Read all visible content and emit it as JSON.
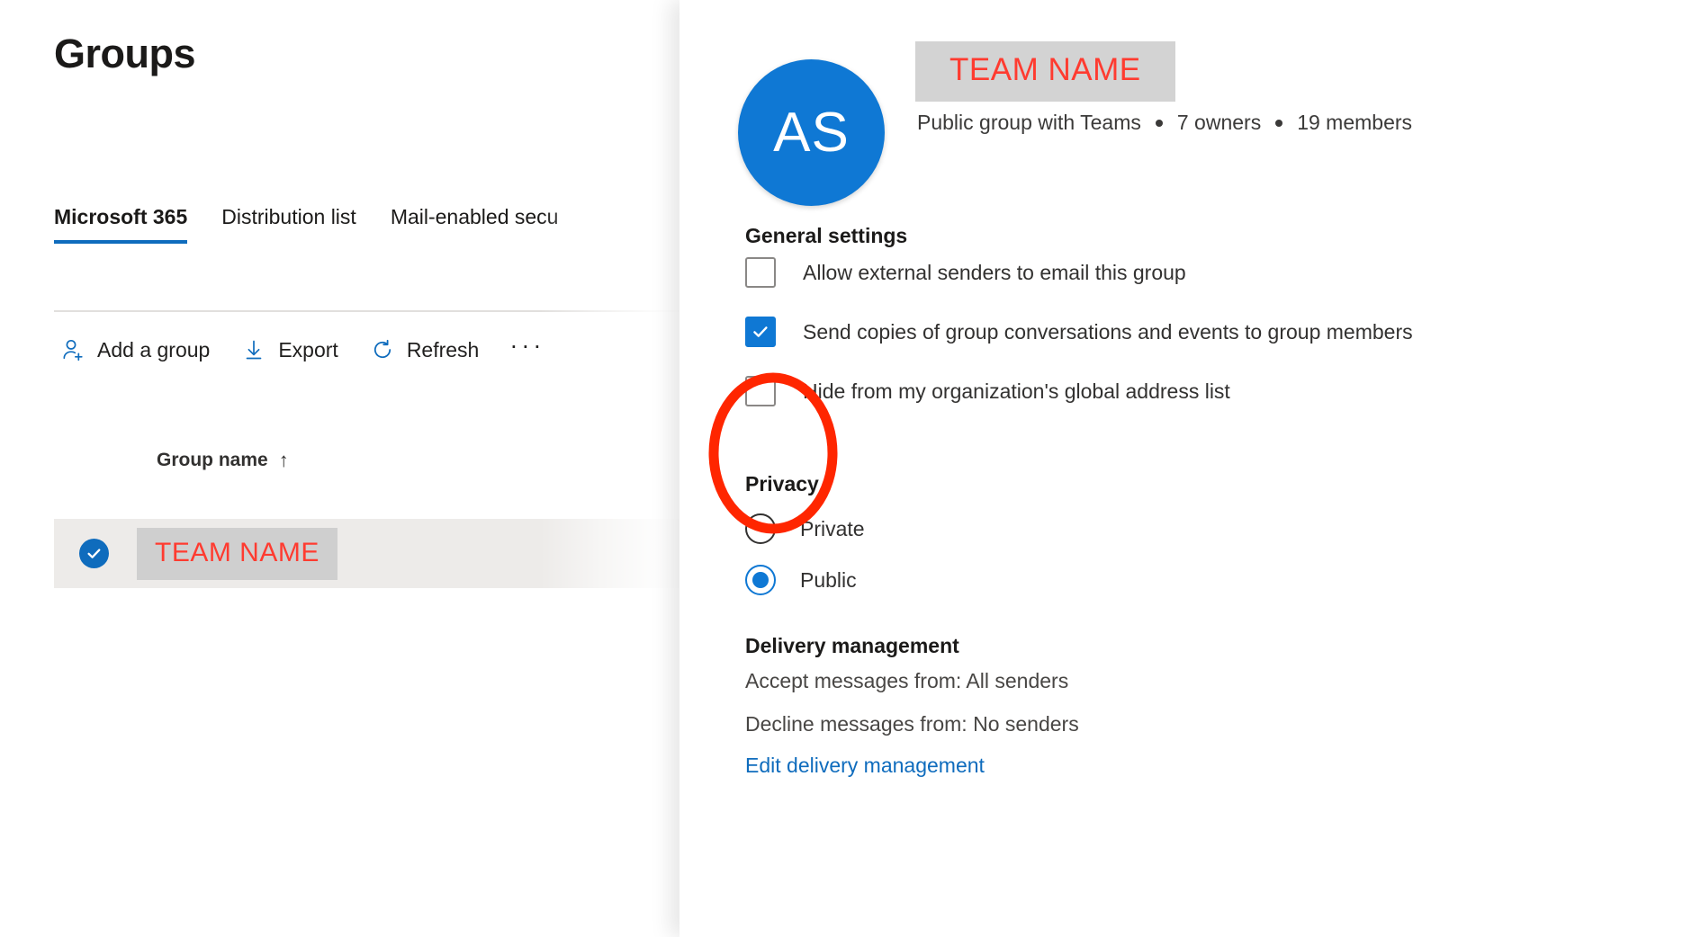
{
  "left_page": {
    "title": "Groups",
    "tabs": [
      {
        "label": "Microsoft 365",
        "selected": true
      },
      {
        "label": "Distribution list",
        "selected": false
      },
      {
        "label": "Mail-enabled secu",
        "selected": false
      }
    ],
    "command_bar": {
      "add_group_label": "Add a group",
      "add_group_icon": "add-user-icon",
      "export_label": "Export",
      "export_icon": "download-arrow-icon",
      "refresh_label": "Refresh",
      "refresh_icon": "refresh-circular-arrow-icon",
      "overflow_label": "···",
      "overflow_icon": "ellipsis-icon"
    },
    "table": {
      "columns": [
        {
          "label": "Group name",
          "sort_indicator": "↑"
        }
      ],
      "rows": [
        {
          "selected": true,
          "group_name": "TEAM NAME",
          "group_name_redacted": true,
          "more_icon": "vertical-ellipsis-icon"
        }
      ]
    }
  },
  "detail_panel": {
    "avatar": {
      "initials": "AS",
      "color": "#0f78d4"
    },
    "group_name": "TEAM NAME",
    "group_name_redacted": true,
    "meta": {
      "type": "Public group with Teams",
      "separator": "•",
      "owners": "7 owners",
      "members": "19 members"
    },
    "delete_icon": "trash-can-icon",
    "general_settings": {
      "heading": "General settings",
      "checkboxes": [
        {
          "label": "Allow external senders to email this group",
          "checked": false
        },
        {
          "label": "Send copies of group conversations and events to group members",
          "checked": true
        },
        {
          "label": "Hide from my organization's global address list",
          "checked": false
        }
      ]
    },
    "privacy": {
      "heading": "Privacy",
      "options": [
        {
          "label": "Private",
          "selected": false
        },
        {
          "label": "Public",
          "selected": true
        }
      ]
    },
    "delivery_management": {
      "heading": "Delivery management",
      "accept": "Accept messages from: All senders",
      "decline": "Decline messages from: No senders",
      "edit_link": "Edit delivery management"
    }
  },
  "annotation": {
    "shape": "ellipse-highlight",
    "color": "#ff2600",
    "stroke_width": 11
  },
  "colors": {
    "accent_blue": "#0f6cbd",
    "avatar_blue": "#0f78d4",
    "redacted_text_red": "#ff3b30",
    "annotation_red": "#ff2600",
    "row_selected_bg": "#edebe9",
    "redaction_box": "#d3d3d3"
  }
}
